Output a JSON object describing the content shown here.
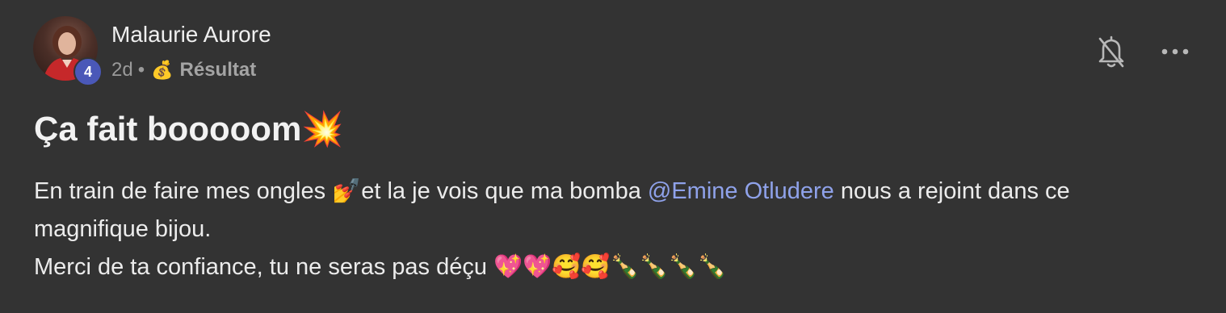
{
  "author": {
    "name": "Malaurie Aurore",
    "level": "4",
    "time": "2d",
    "separator": "•",
    "category_emoji": "💰",
    "category": "Résultat"
  },
  "icons": {
    "notification": "bell-off-icon",
    "more": "more-horizontal-icon"
  },
  "post": {
    "title": "Ça fait booooom💥",
    "body_part1": "En train de faire mes ongles 💅et la je vois que ma bomba ",
    "mention": "@Emine Otludere",
    "body_part2": " nous a rejoint dans ce magnifique bijou.",
    "body_line3": "Merci de ta confiance, tu ne seras pas déçu 💖💖🥰🥰🍾🍾🍾🍾"
  },
  "colors": {
    "background": "#333333",
    "mention": "#8FA2EA",
    "badge": "#4A58B8"
  }
}
